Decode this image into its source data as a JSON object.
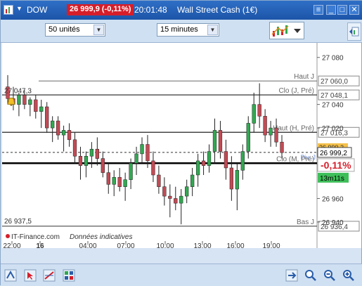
{
  "window": {
    "instrument": "DOW",
    "price_badge": "26 999,9 (-0,11%)",
    "time": "20:01:48",
    "product": "Wall Street Cash (1€)"
  },
  "toolbar": {
    "units_select": "50 unités",
    "interval_select": "15 minutes"
  },
  "chart_data": {
    "type": "candlestick",
    "y_range": [
      26925,
      27090
    ],
    "y_ticks": [
      "27 080",
      "27 040",
      "27 020",
      "26 960",
      "26 940"
    ],
    "x_ticks": [
      "22:00",
      "16",
      "04:00",
      "07:00",
      "10:00",
      "13:00",
      "16:00",
      "19:00"
    ],
    "levels": [
      {
        "name": "Haut J",
        "value_label": "27 060,0",
        "value": 27060.0
      },
      {
        "name": "Clo (J, Pré)",
        "value_label": "27 048,1",
        "value": 27048.1
      },
      {
        "name": "Haut (H, Pré)",
        "value_label": "27 016,3",
        "value": 27016.3
      },
      {
        "name": "Clo (M, Pré)",
        "value_label": "",
        "value": 26990.0
      },
      {
        "name": "Bas J",
        "value_label": "26 936,4",
        "value": 26936.4
      }
    ],
    "last_price_label": "26 999,2",
    "last_price_value": 26999.2,
    "alt_level_label": "26 999,2",
    "pivot_label": "Piv. J",
    "change_label": "-0,11%",
    "countdown_label": "13m11s",
    "left_high_label": "27 047,3",
    "left_low_label": "26 937,5",
    "footer_source": "IT-Finance.com",
    "footer_note": "Données indicatives",
    "candles": [
      {
        "o": 27055,
        "h": 27065,
        "l": 27040,
        "c": 27045
      },
      {
        "o": 27045,
        "h": 27055,
        "l": 27035,
        "c": 27040
      },
      {
        "o": 27040,
        "h": 27050,
        "l": 27030,
        "c": 27048
      },
      {
        "o": 27048,
        "h": 27052,
        "l": 27036,
        "c": 27040
      },
      {
        "o": 27040,
        "h": 27046,
        "l": 27030,
        "c": 27044
      },
      {
        "o": 27044,
        "h": 27048,
        "l": 27028,
        "c": 27034
      },
      {
        "o": 27034,
        "h": 27044,
        "l": 27020,
        "c": 27038
      },
      {
        "o": 27038,
        "h": 27042,
        "l": 27016,
        "c": 27020
      },
      {
        "o": 27020,
        "h": 27030,
        "l": 27008,
        "c": 27026
      },
      {
        "o": 27026,
        "h": 27030,
        "l": 27010,
        "c": 27014
      },
      {
        "o": 27014,
        "h": 27022,
        "l": 27000,
        "c": 27018
      },
      {
        "o": 27018,
        "h": 27024,
        "l": 27004,
        "c": 27010
      },
      {
        "o": 27010,
        "h": 27016,
        "l": 26990,
        "c": 26996
      },
      {
        "o": 26996,
        "h": 27004,
        "l": 26976,
        "c": 26988
      },
      {
        "o": 26988,
        "h": 27000,
        "l": 26978,
        "c": 26996
      },
      {
        "o": 26996,
        "h": 27008,
        "l": 26986,
        "c": 27002
      },
      {
        "o": 27002,
        "h": 27012,
        "l": 26988,
        "c": 26994
      },
      {
        "o": 26994,
        "h": 27000,
        "l": 26978,
        "c": 26982
      },
      {
        "o": 26982,
        "h": 26990,
        "l": 26964,
        "c": 26972
      },
      {
        "o": 26972,
        "h": 26984,
        "l": 26962,
        "c": 26978
      },
      {
        "o": 26978,
        "h": 26986,
        "l": 26966,
        "c": 26970
      },
      {
        "o": 26970,
        "h": 26982,
        "l": 26958,
        "c": 26976
      },
      {
        "o": 26976,
        "h": 26994,
        "l": 26968,
        "c": 26990
      },
      {
        "o": 26990,
        "h": 27004,
        "l": 26980,
        "c": 26998
      },
      {
        "o": 26998,
        "h": 27012,
        "l": 26990,
        "c": 27006
      },
      {
        "o": 27006,
        "h": 27014,
        "l": 26986,
        "c": 26992
      },
      {
        "o": 26992,
        "h": 27000,
        "l": 26974,
        "c": 26980
      },
      {
        "o": 26980,
        "h": 26988,
        "l": 26964,
        "c": 26970
      },
      {
        "o": 26970,
        "h": 26978,
        "l": 26954,
        "c": 26962
      },
      {
        "o": 26962,
        "h": 26972,
        "l": 26944,
        "c": 26960
      },
      {
        "o": 26960,
        "h": 26970,
        "l": 26950,
        "c": 26956
      },
      {
        "o": 26956,
        "h": 26968,
        "l": 26938,
        "c": 26962
      },
      {
        "o": 26962,
        "h": 26976,
        "l": 26956,
        "c": 26970
      },
      {
        "o": 26970,
        "h": 26986,
        "l": 26962,
        "c": 26980
      },
      {
        "o": 26980,
        "h": 26998,
        "l": 26970,
        "c": 26992
      },
      {
        "o": 26992,
        "h": 27000,
        "l": 26980,
        "c": 26988
      },
      {
        "o": 26988,
        "h": 27006,
        "l": 26982,
        "c": 27000
      },
      {
        "o": 27000,
        "h": 27028,
        "l": 26990,
        "c": 27018
      },
      {
        "o": 27018,
        "h": 27026,
        "l": 26994,
        "c": 27000
      },
      {
        "o": 27000,
        "h": 27010,
        "l": 26976,
        "c": 26986
      },
      {
        "o": 26986,
        "h": 26996,
        "l": 26958,
        "c": 26968
      },
      {
        "o": 26968,
        "h": 26990,
        "l": 26950,
        "c": 26984
      },
      {
        "o": 26984,
        "h": 27006,
        "l": 26976,
        "c": 27000
      },
      {
        "o": 27000,
        "h": 27030,
        "l": 26994,
        "c": 27024
      },
      {
        "o": 27024,
        "h": 27050,
        "l": 27016,
        "c": 27040
      },
      {
        "o": 27040,
        "h": 27058,
        "l": 27020,
        "c": 27030
      },
      {
        "o": 27030,
        "h": 27036,
        "l": 27008,
        "c": 27014
      },
      {
        "o": 27014,
        "h": 27026,
        "l": 27004,
        "c": 27020
      },
      {
        "o": 27020,
        "h": 27028,
        "l": 27004,
        "c": 27008
      },
      {
        "o": 27008,
        "h": 27014,
        "l": 26994,
        "c": 26999
      }
    ]
  }
}
